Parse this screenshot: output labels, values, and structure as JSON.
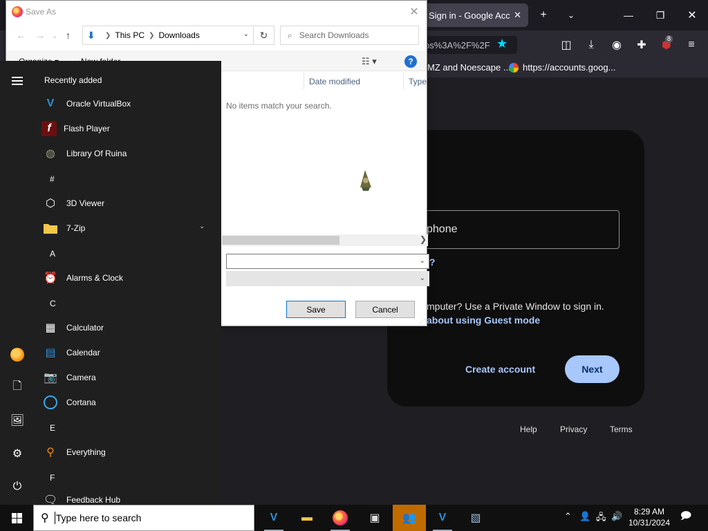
{
  "browser": {
    "tab_title": "Sign in - Google Accou",
    "url_partial": "ps%3A%2F%2F",
    "bookmarks": [
      "MZ and Noescape ...",
      "https://accounts.goog..."
    ],
    "extension_badge": "8",
    "google": {
      "field_value": "phone",
      "forgot_partial": "l?",
      "guest_text": "mputer? Use a Private Window to sign in.",
      "guest_link": "about using Guest mode",
      "create_account": "Create account",
      "next": "Next",
      "footer": [
        "Help",
        "Privacy",
        "Terms"
      ]
    }
  },
  "dialog": {
    "title": "Save As",
    "path": [
      "This PC",
      "Downloads"
    ],
    "search_placeholder": "Search Downloads",
    "organize": "Organize ▾",
    "new_folder": "New folder",
    "columns": [
      "Date modified",
      "Type"
    ],
    "empty_message": "No items match your search.",
    "save": "Save",
    "cancel": "Cancel"
  },
  "start_menu": {
    "recent_header": "Recently added",
    "recent": [
      "Oracle VirtualBox",
      "Flash Player",
      "Library Of Ruina"
    ],
    "groups": [
      {
        "letter": "#",
        "apps": [
          "3D Viewer",
          "7-Zip"
        ]
      },
      {
        "letter": "A",
        "apps": [
          "Alarms & Clock"
        ]
      },
      {
        "letter": "C",
        "apps": [
          "Calculator",
          "Calendar",
          "Camera",
          "Cortana"
        ]
      },
      {
        "letter": "E",
        "apps": [
          "Everything"
        ]
      },
      {
        "letter": "F",
        "apps": [
          "Feedback Hub"
        ]
      }
    ]
  },
  "taskbar": {
    "search_placeholder": "Type here to search",
    "time": "8:29 AM",
    "date": "10/31/2024"
  },
  "colors": {
    "accent_blue": "#a8c7fa",
    "taskbar_active": "#c06b00",
    "dialog_primary": "#0078d7"
  }
}
